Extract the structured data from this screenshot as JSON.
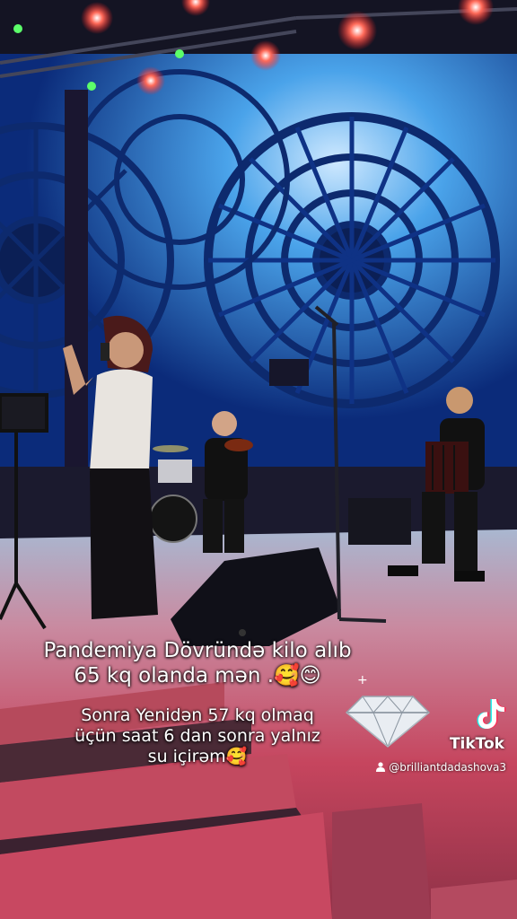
{
  "caption": {
    "line1": "Pandemiya Dövründə kilo alıb",
    "line2": "65 kq olanda mən .🥰😊",
    "line3": "Sonra Yenidən 57 kq olmaq",
    "line4": "üçün saat 6 dan sonra yalnız",
    "line5": "su içirəm🥰"
  },
  "watermark": {
    "brand": "TikTok",
    "username": "@brilliantdadashova3",
    "logo_icon": "tiktok-logo-icon",
    "user_icon": "person-icon"
  },
  "decorations": {
    "diamond_icon": "diamond-icon",
    "sparkle_icon": "sparkle-icon",
    "sparkle_glyph": "+"
  },
  "colors": {
    "stage_screen": "#2b8fe0",
    "stage_floor": "#c44a6a",
    "stage_lights": "#ff3b3b",
    "text": "#ffffff"
  }
}
